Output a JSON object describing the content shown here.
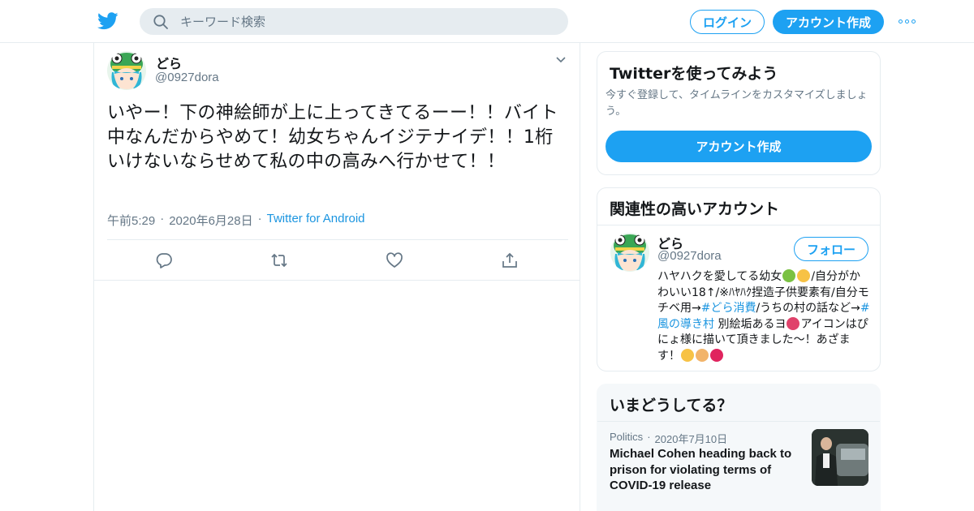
{
  "header": {
    "search_placeholder": "キーワード検索",
    "login_label": "ログイン",
    "signup_label": "アカウント作成",
    "brand_color": "#1da1f2"
  },
  "tweet": {
    "name": "どら",
    "handle": "@0927dora",
    "text": "いやー！下の神絵師が上に上ってきてるーー！！バイト中なんだからやめて！幼女ちゃんイジテナイデ！！1桁いけないならせめて私の中の高みへ行かせて！！",
    "time": "午前5:29",
    "date": "2020年6月28日",
    "source": "Twitter for Android",
    "separator": "·"
  },
  "sidebar": {
    "try": {
      "title": "Twitterを使ってみよう",
      "description": "今すぐ登録して、タイムラインをカスタマイズしましょう。",
      "button": "アカウント作成"
    },
    "related": {
      "title": "関連性の高いアカウント",
      "name": "どら",
      "handle": "@0927dora",
      "follow_label": "フォロー",
      "bio_1": "ハヤハクを愛してる幼女",
      "bio_2": "/自分がかわいい18↑/※ﾊﾔﾊｸ捏造子供要素有/自分モチベ用→",
      "bio_tag_1": "#どら消費",
      "bio_3": "/うちの村の話など→",
      "bio_tag_2": "#風の導き村",
      "bio_4": " 別絵垢あるヨ",
      "bio_5": "アイコンはぴにょ様に描いて頂きました〜！あざます！"
    },
    "trends": {
      "title": "いまどうしてる？",
      "category": "Politics",
      "separator": "·",
      "date": "2020年7月10日",
      "headline": "Michael Cohen heading back to prison for violating terms of COVID-19 release"
    }
  }
}
